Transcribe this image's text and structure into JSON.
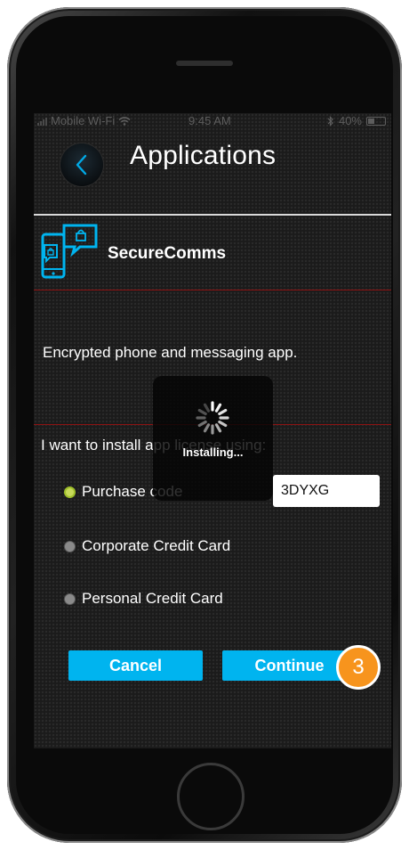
{
  "status_bar": {
    "carrier": "Mobile Wi-Fi",
    "time": "9:45 AM",
    "battery": "40%"
  },
  "header": {
    "title": "Applications",
    "back_icon": "chevron-left-icon"
  },
  "app": {
    "name": "SecureComms",
    "icon": "secure-messaging-icon",
    "description": "Encrypted phone and messaging app."
  },
  "license": {
    "prompt": "I want to install app license using:",
    "options": [
      {
        "label": "Purchase code",
        "selected": true
      },
      {
        "label": "Corporate Credit Card",
        "selected": false
      },
      {
        "label": "Personal Credit Card",
        "selected": false
      }
    ],
    "purchase_code_value": "3DYXG"
  },
  "actions": {
    "cancel_label": "Cancel",
    "continue_label": "Continue"
  },
  "overlay": {
    "label": "Installing..."
  },
  "step_badge": "3",
  "colors": {
    "accent": "#00b4ef",
    "divider": "#8d1313",
    "badge": "#f7941d",
    "radio_selected": "#c7d95a"
  }
}
